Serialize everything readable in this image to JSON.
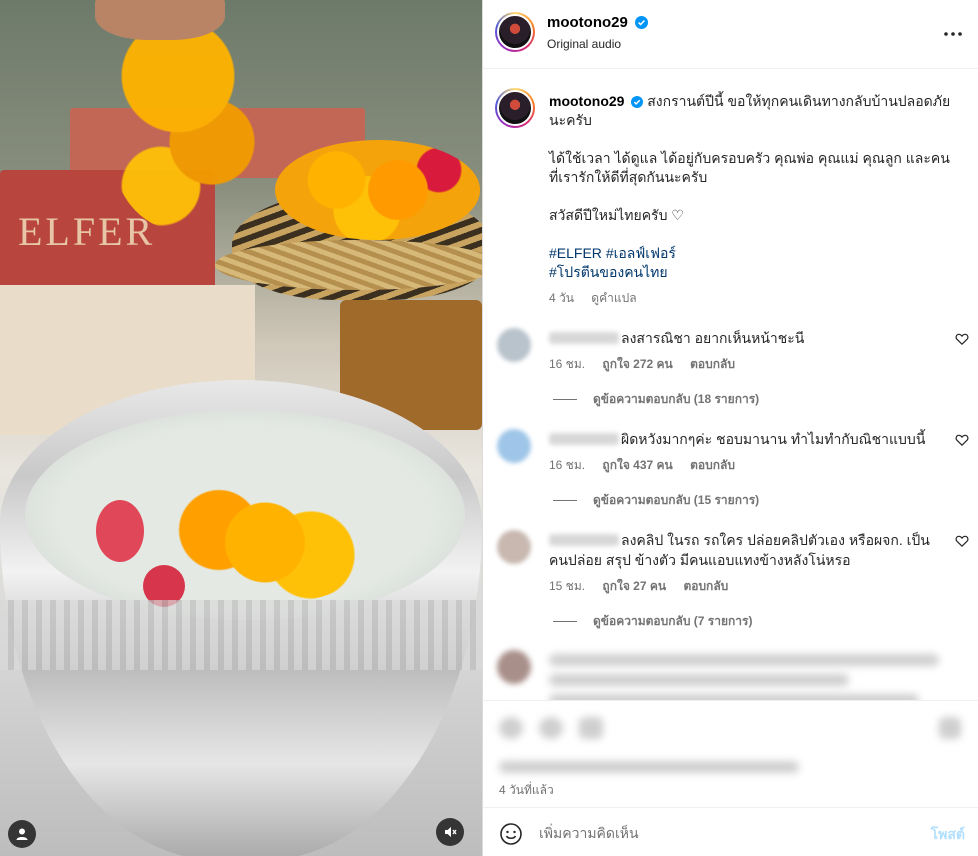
{
  "post": {
    "username": "mootono29",
    "audio_label": "Original audio",
    "more_icon": "more-horizontal-icon"
  },
  "caption": {
    "username": "mootono29",
    "line1": "สงกรานต์ปีนี้ ขอให้ทุกคนเดินทางกลับบ้านปลอดภัยนะครับ",
    "line2": "ได้ใช้เวลา ได้ดูแล ได้อยู่กับครอบครัว คุณพ่อ คุณแม่ คุณลูก และคนที่เรารักให้ดีที่สุดกันนะครับ",
    "line3": "สวัสดีปีใหม่ไทยครับ ♡",
    "hashtag1": "#ELFER",
    "hashtag2": "#เอลฟ์เฟอร์",
    "hashtag3": "#โปรตีนของคนไทย",
    "time": "4 วัน",
    "translate": "ดูคำแปล"
  },
  "comments": [
    {
      "text": "ลงสารณิชา อยากเห็นหน้าชะนี",
      "time": "16 ชม.",
      "likes": "ถูกใจ 272 คน",
      "reply": "ตอบกลับ",
      "view_replies": "ดูข้อความตอบกลับ (18 รายการ)",
      "avatar_color": "#b9c3cc"
    },
    {
      "text": "ผิดหวังมากๆค่ะ ชอบมานาน ทำไมทำกับณิชาแบบนี้",
      "time": "16 ชม.",
      "likes": "ถูกใจ 437 คน",
      "reply": "ตอบกลับ",
      "view_replies": "ดูข้อความตอบกลับ (15 รายการ)",
      "avatar_color": "#9fc6e8"
    },
    {
      "text": "ลงคลิป ในรถ รถใคร ปล่อยคลิปตัวเอง หรือผจก. เป็นคนปล่อย สรุป ข้างตัว มีคนแอบแทงข้างหลังโน่หรอ",
      "time": "15 ชม.",
      "likes": "ถูกใจ 27 คน",
      "reply": "ตอบกลับ",
      "view_replies": "ดูข้อความตอบกลับ (7 รายการ)",
      "avatar_color": "#c8b8b0"
    }
  ],
  "footer": {
    "date": "4 วันที่แล้ว",
    "comment_placeholder": "เพิ่มความคิดเห็น",
    "post_label": "โพสต์"
  },
  "media_text": {
    "box_label": "ELFER"
  }
}
